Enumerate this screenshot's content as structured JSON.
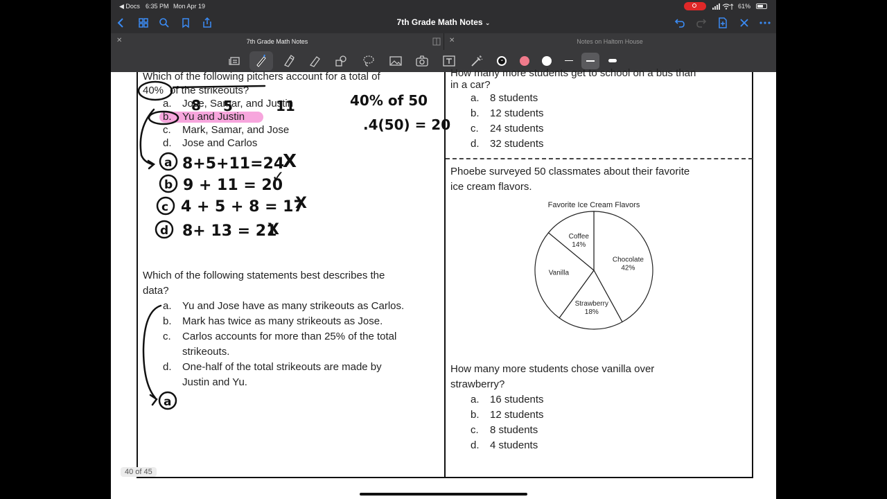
{
  "status": {
    "back_app": "◀ Docs",
    "time": "6:35 PM",
    "date": "Mon Apr 19",
    "battery": "61%"
  },
  "nav": {
    "title": "7th Grade Math Notes"
  },
  "tabs": [
    {
      "label": "7th Grade Math Notes"
    },
    {
      "label": "Notes on Haltom House"
    }
  ],
  "colors": {
    "toolbar_bg": "#39393b",
    "highlight": "#f7a6dd",
    "record": "#e02828"
  },
  "q1": {
    "line1": "Which of the following pitchers account for a total of",
    "line2_a": "40%",
    "line2_b": "of the strikeouts?",
    "options": [
      {
        "letter": "a.",
        "text": "Jose, Samar, and Justin"
      },
      {
        "letter": "b.",
        "text": "Yu and Justin"
      },
      {
        "letter": "c.",
        "text": "Mark, Samar, and Jose"
      },
      {
        "letter": "d.",
        "text": "Jose and Carlos"
      }
    ]
  },
  "q2": {
    "line1": "Which of the following statements best describes the",
    "line2": "data?",
    "options": [
      {
        "letter": "a.",
        "text": "Yu and Jose have as many strikeouts as Carlos."
      },
      {
        "letter": "b.",
        "text": "Mark has twice as many strikeouts as Jose."
      },
      {
        "letter": "c.",
        "text": "Carlos accounts for more than 25% of the total",
        "text2": "strikeouts."
      },
      {
        "letter": "d.",
        "text": "One-half of the total strikeouts are made by",
        "text2": "Justin and Yu."
      }
    ]
  },
  "q3": {
    "line1": "How many more students get to school on a bus than",
    "line2": "in a car?",
    "options": [
      {
        "letter": "a.",
        "text": "8 students"
      },
      {
        "letter": "b.",
        "text": "12 students"
      },
      {
        "letter": "c.",
        "text": "24 students"
      },
      {
        "letter": "d.",
        "text": "32 students"
      }
    ]
  },
  "q4": {
    "line1": "Phoebe surveyed 50 classmates about their favorite",
    "line2": "ice cream flavors."
  },
  "q5": {
    "line1": "How many more students chose vanilla over",
    "line2": "strawberry?",
    "options": [
      {
        "letter": "a.",
        "text": "16 students"
      },
      {
        "letter": "b.",
        "text": "12 students"
      },
      {
        "letter": "c.",
        "text": "8 students"
      },
      {
        "letter": "d.",
        "text": "4 students"
      }
    ]
  },
  "chart_data": {
    "type": "pie",
    "title": "Favorite Ice Cream Flavors",
    "slices": [
      {
        "label": "Chocolate",
        "value": 42,
        "value_label": "42%"
      },
      {
        "label": "Strawberry",
        "value": 18,
        "value_label": "18%"
      },
      {
        "label": "Vanilla",
        "value": 26,
        "value_label": ""
      },
      {
        "label": "Coffee",
        "value": 14,
        "value_label": "14%"
      }
    ]
  },
  "handwriting": {
    "col_nums": [
      "8",
      "5",
      "11"
    ],
    "calc1": "40% of 50",
    "calc2": ".4(50) = 20",
    "work": [
      {
        "letter": "a",
        "expr": "8+5+11=24",
        "mark": "X"
      },
      {
        "letter": "b",
        "expr": "9 + 11 = 20",
        "mark": "✓"
      },
      {
        "letter": "c",
        "expr": "4 + 5 + 8 = 17",
        "mark": "X"
      },
      {
        "letter": "d",
        "expr": "8+ 13 = 21",
        "mark": "X"
      }
    ],
    "answer2": "a"
  },
  "page_counter": "40 of 45"
}
